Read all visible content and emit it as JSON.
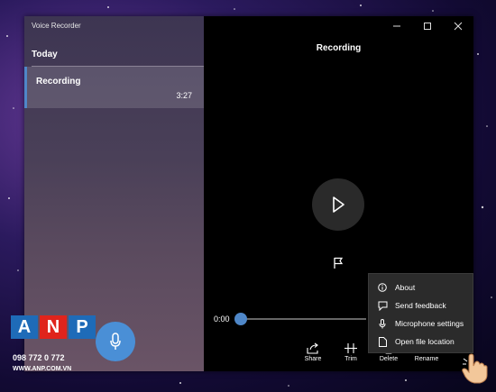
{
  "window": {
    "title": "Voice Recorder"
  },
  "list": {
    "section": "Today",
    "items": [
      {
        "name": "Recording",
        "duration": "3:27"
      }
    ]
  },
  "player": {
    "title": "Recording",
    "current_time": "0:00"
  },
  "toolbar": {
    "share": "Share",
    "trim": "Trim",
    "delete": "Delete",
    "rename": "Rename",
    "more": "..."
  },
  "menu": {
    "items": [
      {
        "label": "About",
        "icon": "info-icon"
      },
      {
        "label": "Send feedback",
        "icon": "feedback-icon"
      },
      {
        "label": "Microphone settings",
        "icon": "microphone-icon"
      },
      {
        "label": "Open file location",
        "icon": "file-icon"
      }
    ]
  },
  "watermark": {
    "phone": "098 772 0 772",
    "site": "WWW.ANP.COM.VN"
  },
  "colors": {
    "accent": "#4f87c8",
    "record_button": "#4a8fd6"
  }
}
